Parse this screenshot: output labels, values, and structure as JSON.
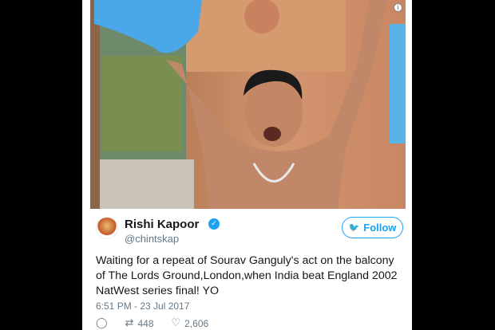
{
  "colors": {
    "accent": "#1da1f2",
    "text": "#14171a",
    "muted": "#657786"
  },
  "tweet": {
    "author_name": "Rishi Kapoor",
    "handle": "@chintskap",
    "follow_label": "Follow",
    "text": "Waiting for a repeat of Sourav Ganguly's act on the balcony of The Lords Ground,London,when India beat England 2002 NatWest series final! YO",
    "timestamp": "6:51 PM - 23 Jul 2017",
    "retweets": "448",
    "likes": "2,606"
  },
  "icons": {
    "info": "info-icon",
    "verified": "verified-badge-icon",
    "follow_bird": "twitter-bird-icon",
    "reply": "reply-icon",
    "retweet": "retweet-icon",
    "like": "heart-icon"
  }
}
